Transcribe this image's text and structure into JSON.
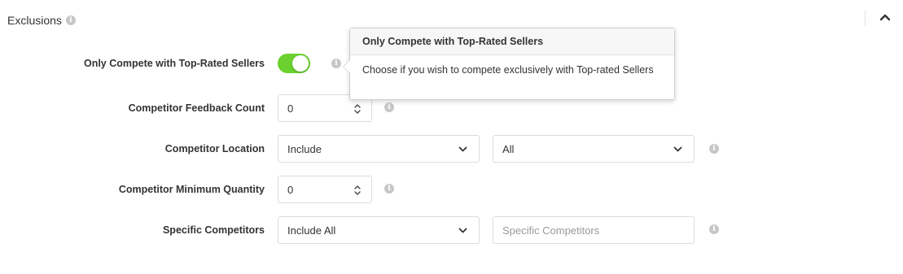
{
  "section": {
    "title": "Exclusions",
    "info_icon": "info-icon",
    "collapse_icon": "chevron-up-icon"
  },
  "rows": {
    "top_rated": {
      "label": "Only Compete with Top-Rated Sellers",
      "enabled": true,
      "toggle_color": "#6ad12f"
    },
    "feedback_count": {
      "label": "Competitor Feedback Count",
      "value": "0"
    },
    "location": {
      "label": "Competitor Location",
      "mode_value": "Include",
      "region_value": "All"
    },
    "min_quantity": {
      "label": "Competitor Minimum Quantity",
      "value": "0"
    },
    "specific": {
      "label": "Specific Competitors",
      "mode_value": "Include All",
      "input_placeholder": "Specific Competitors"
    }
  },
  "tooltip": {
    "title": "Only Compete with Top-Rated Sellers",
    "body": "Choose if you wish to compete exclusively with Top-rated Sellers"
  }
}
